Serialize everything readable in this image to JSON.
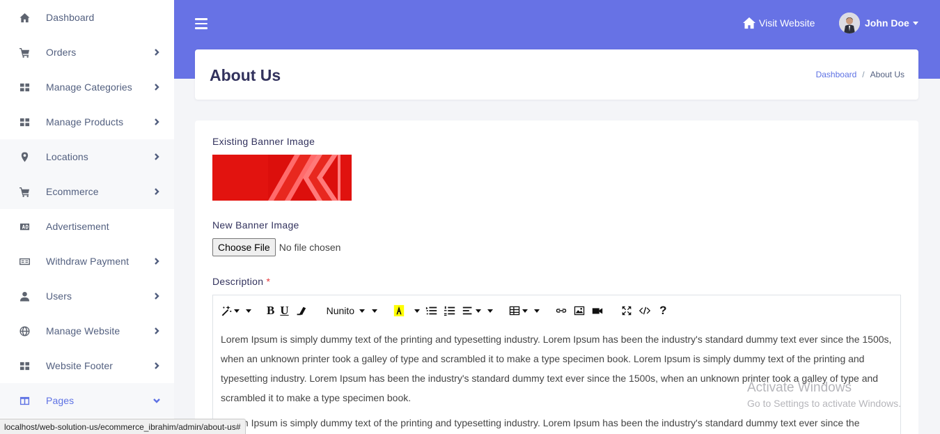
{
  "sidebar": {
    "items": [
      {
        "label": "Dashboard",
        "icon": "home-icon",
        "chevron": false,
        "shaded": false,
        "active": false
      },
      {
        "label": "Orders",
        "icon": "cart-icon",
        "chevron": true,
        "shaded": false,
        "active": false
      },
      {
        "label": "Manage Categories",
        "icon": "grid-icon",
        "chevron": true,
        "shaded": false,
        "active": false
      },
      {
        "label": "Manage Products",
        "icon": "grid-icon",
        "chevron": true,
        "shaded": false,
        "active": false
      },
      {
        "label": "Locations",
        "icon": "map-pin-icon",
        "chevron": true,
        "shaded": true,
        "active": false
      },
      {
        "label": "Ecommerce",
        "icon": "cart-icon",
        "chevron": true,
        "shaded": true,
        "active": false
      },
      {
        "label": "Advertisement",
        "icon": "ad-icon",
        "chevron": false,
        "shaded": false,
        "active": false
      },
      {
        "label": "Withdraw Payment",
        "icon": "money-icon",
        "chevron": true,
        "shaded": false,
        "active": false
      },
      {
        "label": "Users",
        "icon": "user-icon",
        "chevron": true,
        "shaded": false,
        "active": false
      },
      {
        "label": "Manage Website",
        "icon": "globe-icon",
        "chevron": true,
        "shaded": false,
        "active": false
      },
      {
        "label": "Website Footer",
        "icon": "grid-icon",
        "chevron": true,
        "shaded": false,
        "active": false
      },
      {
        "label": "Pages",
        "icon": "columns-icon",
        "chevron": true,
        "shaded": true,
        "active": true
      }
    ]
  },
  "header": {
    "visit_label": "Visit Website",
    "user_name": "John Doe"
  },
  "page": {
    "title": "About Us",
    "breadcrumb": {
      "home": "Dashboard",
      "separator": "/",
      "current": "About Us"
    }
  },
  "form": {
    "existing_banner_label": "Existing Banner Image",
    "new_banner_label": "New Banner Image",
    "file_button": "Choose File",
    "file_status": "No file chosen",
    "description_label": "Description",
    "required_mark": "*"
  },
  "editor": {
    "font_name": "Nunito",
    "paragraphs": [
      "Lorem Ipsum is simply dummy text of the printing and typesetting industry. Lorem Ipsum has been the industry's standard dummy text ever since the 1500s, when an unknown printer took a galley of type and scrambled it to make a type specimen book. Lorem Ipsum is simply dummy text of the printing and typesetting industry. Lorem Ipsum has been the industry's standard dummy text ever since the 1500s, when an unknown printer took a galley of type and scrambled it to make a type specimen book.",
      "Lorem Ipsum is simply dummy text of the printing and typesetting industry. Lorem Ipsum has been the industry's standard dummy text ever since the"
    ]
  },
  "watermark": {
    "title": "Activate Windows",
    "subtitle": "Go to Settings to activate Windows."
  },
  "status_url": "localhost/web-solution-us/ecommerce_ibrahim/admin/about-us#",
  "colors": {
    "accent": "#6772e5",
    "active": "#5e72e4",
    "required": "#e5383b"
  }
}
